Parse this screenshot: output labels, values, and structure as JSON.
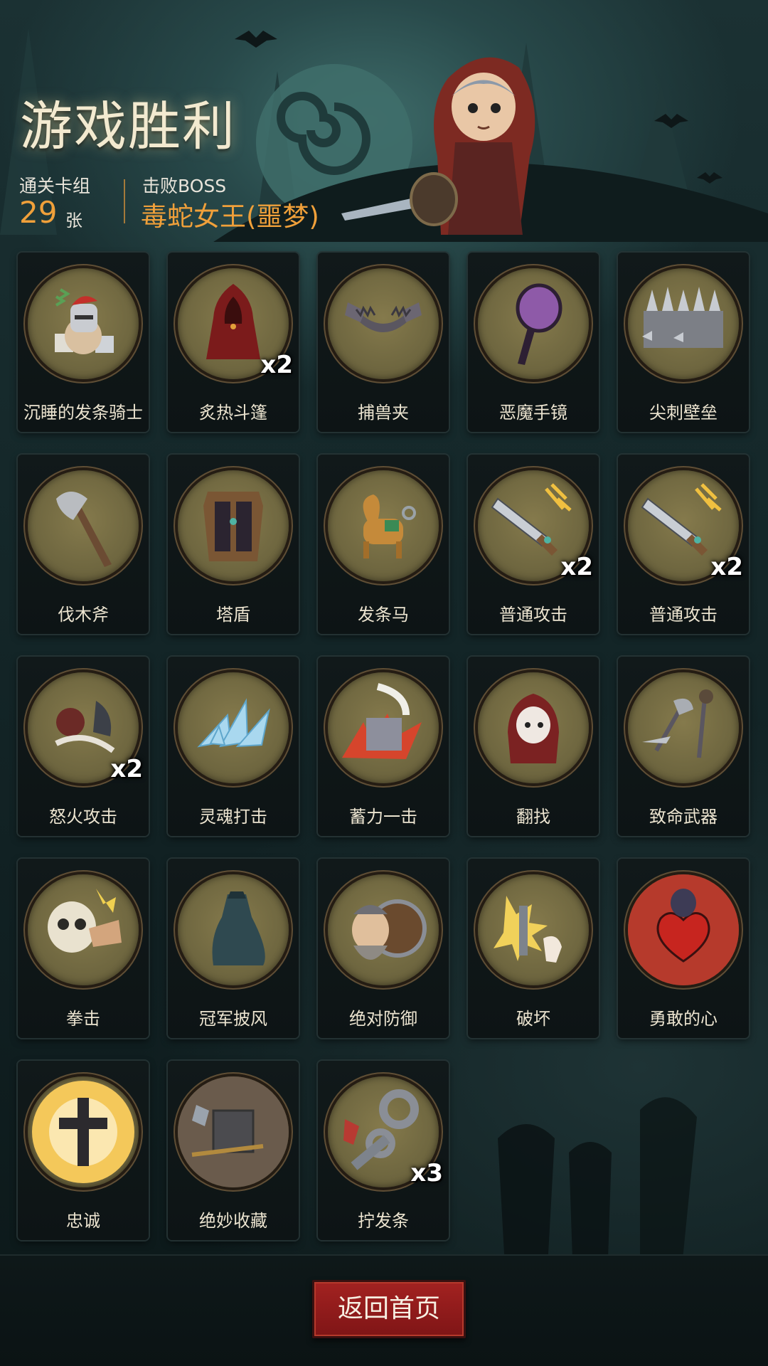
{
  "header": {
    "title": "游戏胜利",
    "deck_label": "通关卡组",
    "deck_count": "29",
    "deck_unit": "张",
    "boss_label": "击败BOSS",
    "boss_name": "毒蛇女王(噩梦)"
  },
  "cards": [
    {
      "name": "沉睡的发条骑士",
      "multiplier": "",
      "icon": "sleeping-knight-icon"
    },
    {
      "name": "炙热斗篷",
      "multiplier": "x2",
      "icon": "red-cloak-icon"
    },
    {
      "name": "捕兽夹",
      "multiplier": "",
      "icon": "bear-trap-icon"
    },
    {
      "name": "恶魔手镜",
      "multiplier": "",
      "icon": "demon-mirror-icon"
    },
    {
      "name": "尖刺壁垒",
      "multiplier": "",
      "icon": "spike-wall-icon"
    },
    {
      "name": "伐木斧",
      "multiplier": "",
      "icon": "axe-icon"
    },
    {
      "name": "塔盾",
      "multiplier": "",
      "icon": "tower-shield-icon"
    },
    {
      "name": "发条马",
      "multiplier": "",
      "icon": "clockwork-horse-icon"
    },
    {
      "name": "普通攻击",
      "multiplier": "x2",
      "icon": "sword-icon"
    },
    {
      "name": "普通攻击",
      "multiplier": "x2",
      "icon": "sword-icon"
    },
    {
      "name": "怒火攻击",
      "multiplier": "x2",
      "icon": "rage-attack-icon"
    },
    {
      "name": "灵魂打击",
      "multiplier": "",
      "icon": "ice-shards-icon"
    },
    {
      "name": "蓄力一击",
      "multiplier": "",
      "icon": "charged-strike-icon"
    },
    {
      "name": "翻找",
      "multiplier": "",
      "icon": "hooded-girl-icon"
    },
    {
      "name": "致命武器",
      "multiplier": "",
      "icon": "weapons-icon"
    },
    {
      "name": "拳击",
      "multiplier": "",
      "icon": "skull-punch-icon"
    },
    {
      "name": "冠军披风",
      "multiplier": "",
      "icon": "champion-cape-icon"
    },
    {
      "name": "绝对防御",
      "multiplier": "",
      "icon": "dwarf-shield-icon"
    },
    {
      "name": "破坏",
      "multiplier": "",
      "icon": "break-icon"
    },
    {
      "name": "勇敢的心",
      "multiplier": "",
      "icon": "brave-heart-icon"
    },
    {
      "name": "忠诚",
      "multiplier": "",
      "icon": "holy-cross-icon"
    },
    {
      "name": "绝妙收藏",
      "multiplier": "",
      "icon": "collection-icon"
    },
    {
      "name": "拧发条",
      "multiplier": "x3",
      "icon": "wind-up-key-icon"
    }
  ],
  "footer": {
    "home_button": "返回首页"
  },
  "colors": {
    "accent_orange": "#f0a03a",
    "button_red": "#a32221",
    "emblem_olive": "#7a7148"
  }
}
